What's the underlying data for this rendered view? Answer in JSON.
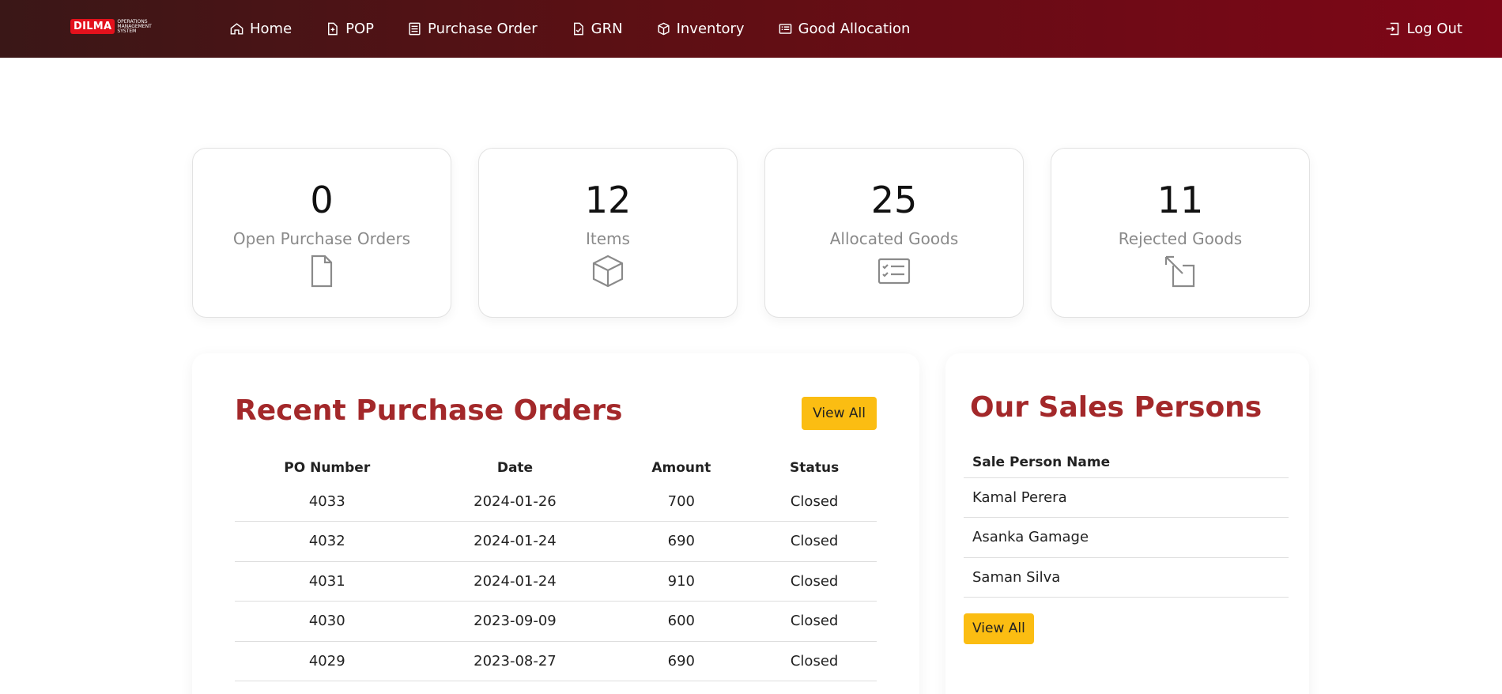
{
  "brand": {
    "badge": "DILMA",
    "tagline_lines": [
      "OPERATIONS",
      "MANAGEMENT",
      "SYSTEM"
    ]
  },
  "nav": {
    "items": [
      {
        "label": "Home",
        "icon": "home-icon"
      },
      {
        "label": "POP",
        "icon": "file-plus-icon"
      },
      {
        "label": "Purchase Order",
        "icon": "document-list-icon"
      },
      {
        "label": "GRN",
        "icon": "file-check-icon"
      },
      {
        "label": "Inventory",
        "icon": "box-icon"
      },
      {
        "label": "Good Allocation",
        "icon": "list-card-icon"
      }
    ],
    "logout_label": "Log Out"
  },
  "stats": [
    {
      "value": "0",
      "label": "Open Purchase Orders",
      "icon": "file-icon"
    },
    {
      "value": "12",
      "label": "Items",
      "icon": "box-icon"
    },
    {
      "value": "25",
      "label": "Allocated Goods",
      "icon": "checklist-icon"
    },
    {
      "value": "11",
      "label": "Rejected Goods",
      "icon": "arrow-expand-icon"
    }
  ],
  "recent_po": {
    "title": "Recent Purchase Orders",
    "view_all": "View All",
    "columns": [
      "PO Number",
      "Date",
      "Amount",
      "Status"
    ],
    "rows": [
      [
        "4033",
        "2024-01-26",
        "700",
        "Closed"
      ],
      [
        "4032",
        "2024-01-24",
        "690",
        "Closed"
      ],
      [
        "4031",
        "2024-01-24",
        "910",
        "Closed"
      ],
      [
        "4030",
        "2023-09-09",
        "600",
        "Closed"
      ],
      [
        "4029",
        "2023-08-27",
        "690",
        "Closed"
      ]
    ]
  },
  "sales": {
    "title": "Our Sales Persons",
    "column": "Sale Person Name",
    "people": [
      "Kamal Perera",
      "Asanka Gamage",
      "Saman Silva"
    ],
    "view_all": "View All"
  },
  "colors": {
    "accent": "#a3282a",
    "button": "#fbbd12",
    "nav_start": "#3a1717",
    "nav_end": "#7e0617"
  }
}
